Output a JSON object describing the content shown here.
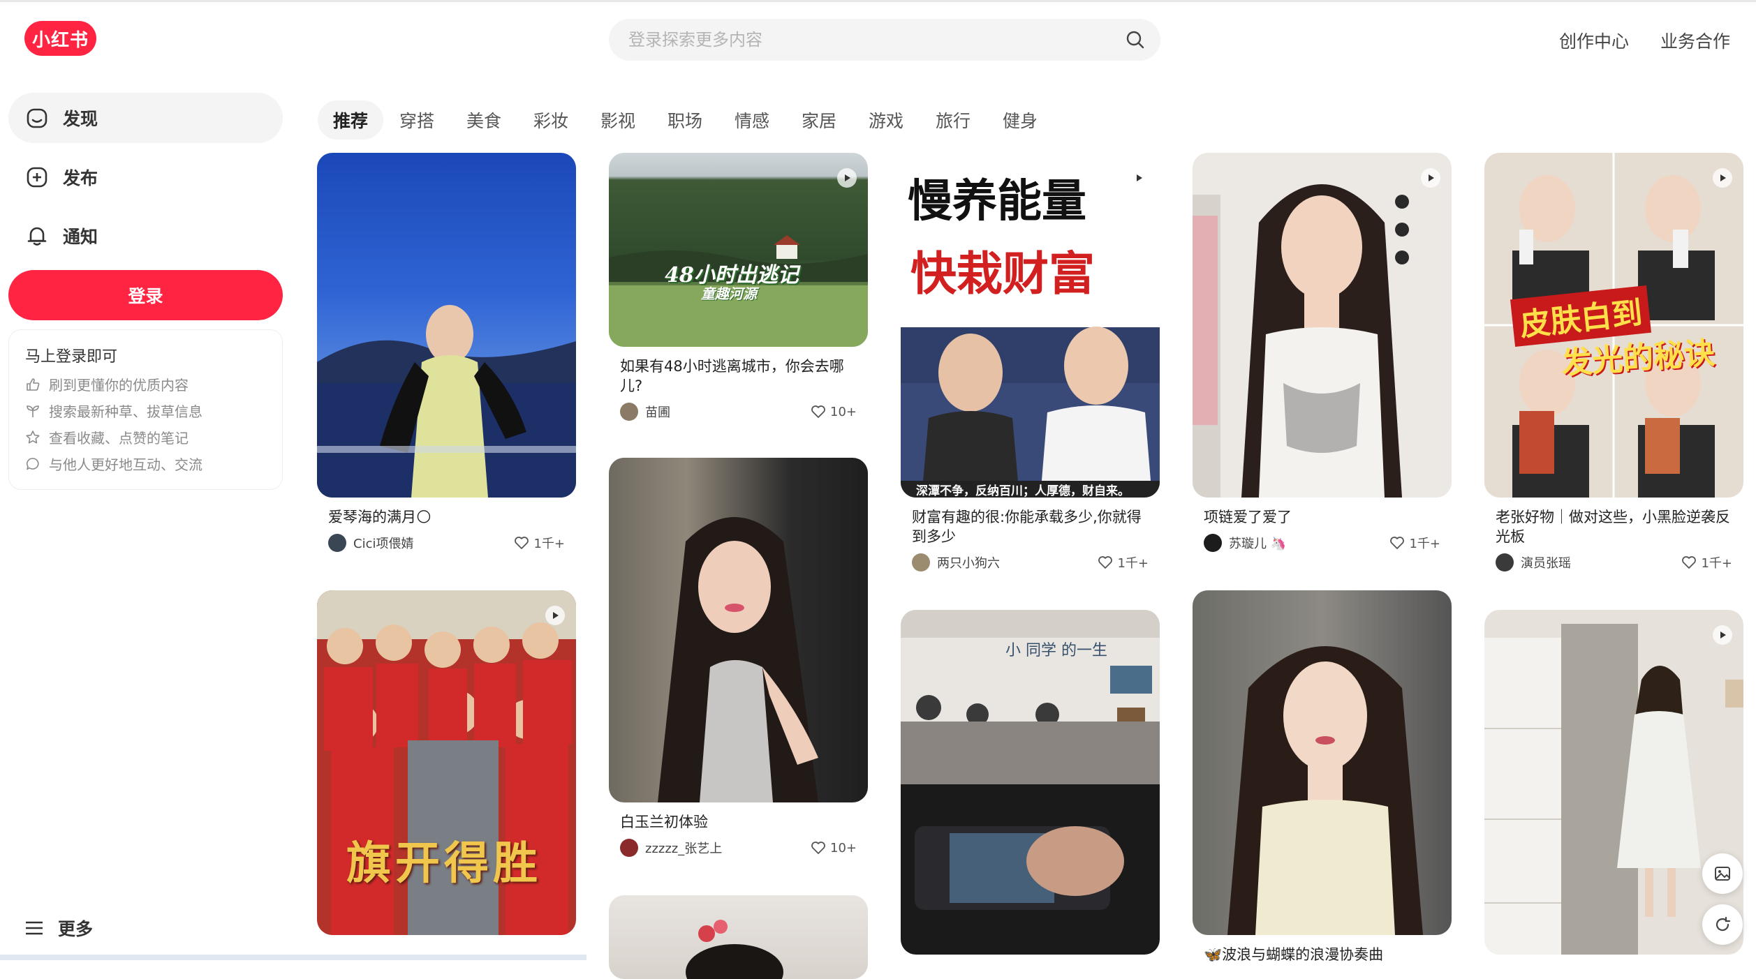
{
  "header": {
    "logo": "小红书",
    "search_placeholder": "登录探索更多内容",
    "links": [
      "创作中心",
      "业务合作"
    ]
  },
  "sidebar": {
    "items": [
      {
        "label": "发现",
        "icon": "home-icon"
      },
      {
        "label": "发布",
        "icon": "plus-icon"
      },
      {
        "label": "通知",
        "icon": "bell-icon"
      }
    ],
    "login_label": "登录",
    "tip": {
      "title": "马上登录即可",
      "rows": [
        {
          "icon": "thumbs-up-icon",
          "text": "刷到更懂你的优质内容"
        },
        {
          "icon": "sprout-icon",
          "text": "搜索最新种草、拔草信息"
        },
        {
          "icon": "star-icon",
          "text": "查看收藏、点赞的笔记"
        },
        {
          "icon": "chat-icon",
          "text": "与他人更好地互动、交流"
        }
      ]
    },
    "more_label": "更多"
  },
  "tabs": [
    "推荐",
    "穿搭",
    "美食",
    "彩妆",
    "影视",
    "职场",
    "情感",
    "家居",
    "游戏",
    "旅行",
    "健身"
  ],
  "cards": [
    {
      "title": "爱琴海的满月🌕",
      "author": "Cici项偎婧",
      "likes": "1千+",
      "overlay": "",
      "overlay2": "",
      "caption": ""
    },
    {
      "title": "",
      "author": "",
      "likes": "",
      "overlay": "旗开得胜",
      "overlay2": "",
      "caption": ""
    },
    {
      "title": "如果有48小时逃离城市，你会去哪儿?",
      "author": "苗圃",
      "likes": "10+",
      "overlay": "48小时出逃记",
      "overlay2": "童趣河源",
      "caption": ""
    },
    {
      "title": "白玉兰初体验",
      "author": "zzzzz_张艺上",
      "likes": "10+",
      "overlay": "",
      "overlay2": "",
      "caption": ""
    },
    {
      "title": "",
      "author": "",
      "likes": "",
      "overlay": "",
      "overlay2": "",
      "caption": ""
    },
    {
      "title": "财富有趣的很:你能承载多少,你就得到多少",
      "author": "两只小狗六",
      "likes": "1千+",
      "overlay": "慢养能量",
      "overlay2": "快栽财富",
      "caption": "深潭不争，反纳百川；人厚德，财自来。"
    },
    {
      "title": "",
      "author": "",
      "likes": "",
      "overlay": "小 同学 的一生",
      "overlay2": "",
      "caption": ""
    },
    {
      "title": "项链爱了爱了",
      "author": "苏璇儿 🦄",
      "likes": "1千+",
      "overlay": "",
      "overlay2": "",
      "caption": ""
    },
    {
      "title": "🦋波浪与蝴蝶的浪漫协奏曲",
      "author": "",
      "likes": "",
      "overlay": "",
      "overlay2": "",
      "caption": ""
    },
    {
      "title": "老张好物｜做对这些，小黑脸逆袭反光板",
      "author": "演员张瑶",
      "likes": "1千+",
      "overlay": "皮肤白到",
      "overlay2": "发光的秘诀",
      "caption": ""
    },
    {
      "title": "",
      "author": "",
      "likes": "",
      "overlay": "",
      "overlay2": "",
      "caption": ""
    }
  ]
}
